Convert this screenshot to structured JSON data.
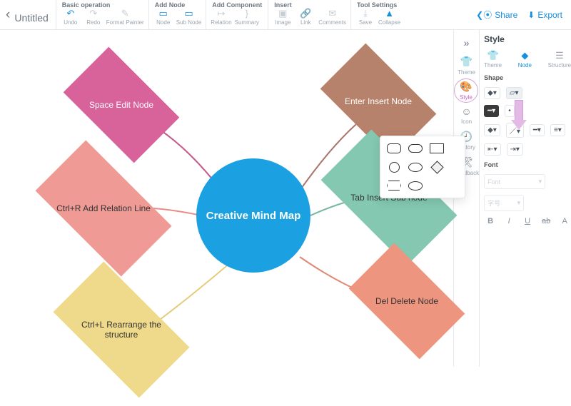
{
  "doc_title": "Untitled",
  "groups": {
    "basic": {
      "label": "Basic operation",
      "items": [
        {
          "id": "undo",
          "label": "Undo",
          "glyph": "↶",
          "dis": false
        },
        {
          "id": "redo",
          "label": "Redo",
          "glyph": "↷",
          "dis": true
        },
        {
          "id": "format",
          "label": "Format Painter",
          "glyph": "✎",
          "dis": true
        }
      ]
    },
    "addnode": {
      "label": "Add Node",
      "items": [
        {
          "id": "node",
          "label": "Node",
          "glyph": "▭",
          "dis": false
        },
        {
          "id": "subnode",
          "label": "Sub Node",
          "glyph": "▭",
          "dis": false
        }
      ]
    },
    "addcomp": {
      "label": "Add Component",
      "items": [
        {
          "id": "relation",
          "label": "Relation",
          "glyph": "↦",
          "dis": true
        },
        {
          "id": "summary",
          "label": "Summary",
          "glyph": "}",
          "dis": true
        }
      ]
    },
    "insert": {
      "label": "Insert",
      "items": [
        {
          "id": "image",
          "label": "Image",
          "glyph": "▣",
          "dis": true
        },
        {
          "id": "link",
          "label": "Link",
          "glyph": "🔗",
          "dis": true
        },
        {
          "id": "comments",
          "label": "Comments",
          "glyph": "✉",
          "dis": true
        }
      ]
    },
    "toolset": {
      "label": "Tool Settings",
      "items": [
        {
          "id": "save",
          "label": "Save",
          "glyph": "⤓",
          "dis": true
        },
        {
          "id": "collapse",
          "label": "Collapse",
          "glyph": "▲",
          "dis": false
        }
      ]
    }
  },
  "actions": {
    "share": "Share",
    "export": "Export"
  },
  "center_node": "Creative Mind Map",
  "nodes": {
    "n1": "Space Edit Node",
    "n2": "Ctrl+R Add Relation Line",
    "n3": "Ctrl+L Rearrange the structure",
    "n4": "Enter Insert Node",
    "n5": "Tab Insert Sub node",
    "n6": "Del Delete Node"
  },
  "sidebar": {
    "items": [
      {
        "id": "theme",
        "label": "Theme",
        "glyph": "👕"
      },
      {
        "id": "style",
        "label": "Style",
        "glyph": "🎨"
      },
      {
        "id": "icon",
        "label": "Icon",
        "glyph": "☺"
      },
      {
        "id": "history",
        "label": "History",
        "glyph": "🕘"
      },
      {
        "id": "feedback",
        "label": "Feedback",
        "glyph": "🛠"
      }
    ]
  },
  "panel": {
    "title": "Style",
    "tabs": [
      {
        "id": "theme",
        "label": "Theme",
        "glyph": "👕"
      },
      {
        "id": "node",
        "label": "Node",
        "glyph": "◆"
      },
      {
        "id": "structure",
        "label": "Structure",
        "glyph": "☰"
      }
    ],
    "shape_label": "Shape",
    "line_label": "—",
    "font_label": "Font",
    "font_placeholder": "Font",
    "size_placeholder": "字号"
  }
}
